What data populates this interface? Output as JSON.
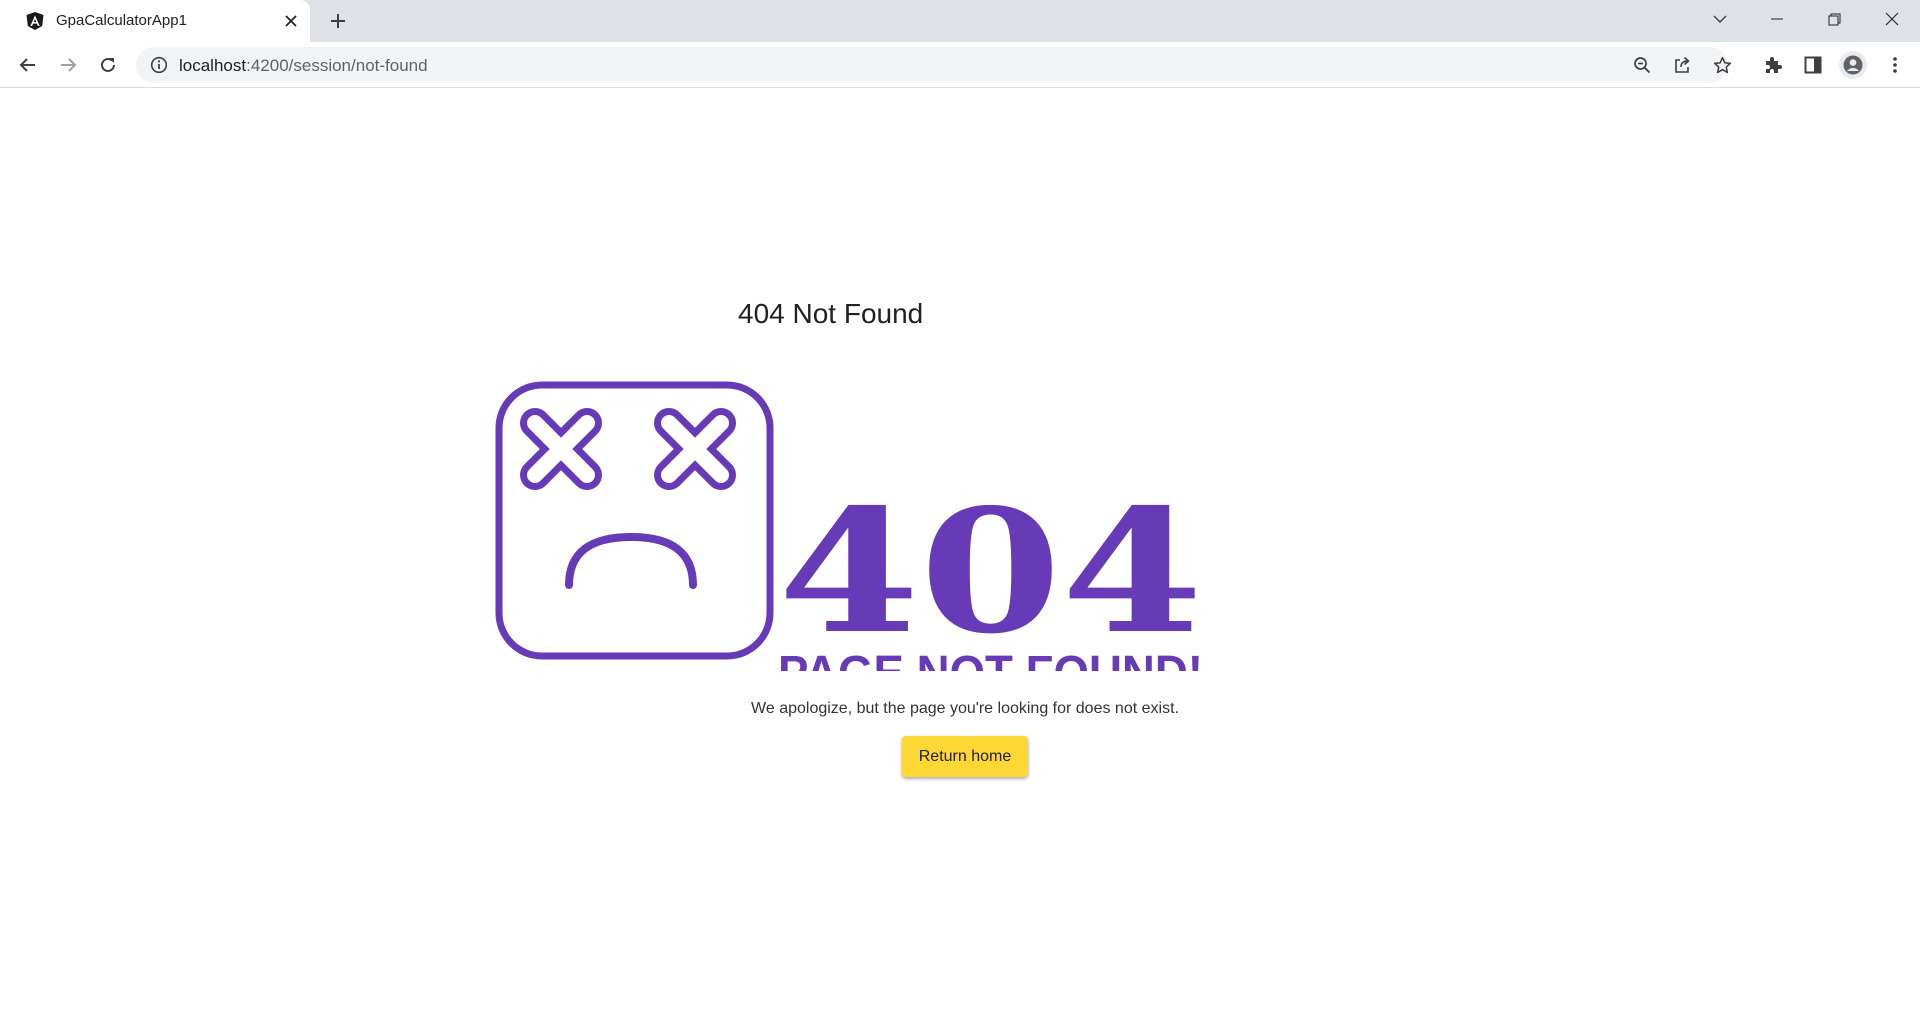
{
  "browser": {
    "tab": {
      "title": "GpaCalculatorApp1",
      "favicon": "angular-icon"
    },
    "address_bar": {
      "host": "localhost",
      "path": ":4200/session/not-found"
    },
    "toolbar_icons": [
      "back-icon",
      "forward-icon",
      "reload-icon",
      "info-icon",
      "zoom-out-icon",
      "share-icon",
      "bookmark-star-icon",
      "extensions-icon",
      "side-panel-icon",
      "profile-icon",
      "menu-icon"
    ],
    "window_controls": [
      "tab-search-icon",
      "minimize-icon",
      "restore-icon",
      "close-icon"
    ]
  },
  "page": {
    "title": "404 Not Found",
    "illustration": {
      "code": "404",
      "caption": "PAGE NOT FOUND!",
      "icon": "sad-face-icon",
      "color": "#673ab7"
    },
    "message": "We apologize, but the page you're looking for does not exist.",
    "return_button": {
      "label": "Return home",
      "color": "#fdd835"
    }
  }
}
